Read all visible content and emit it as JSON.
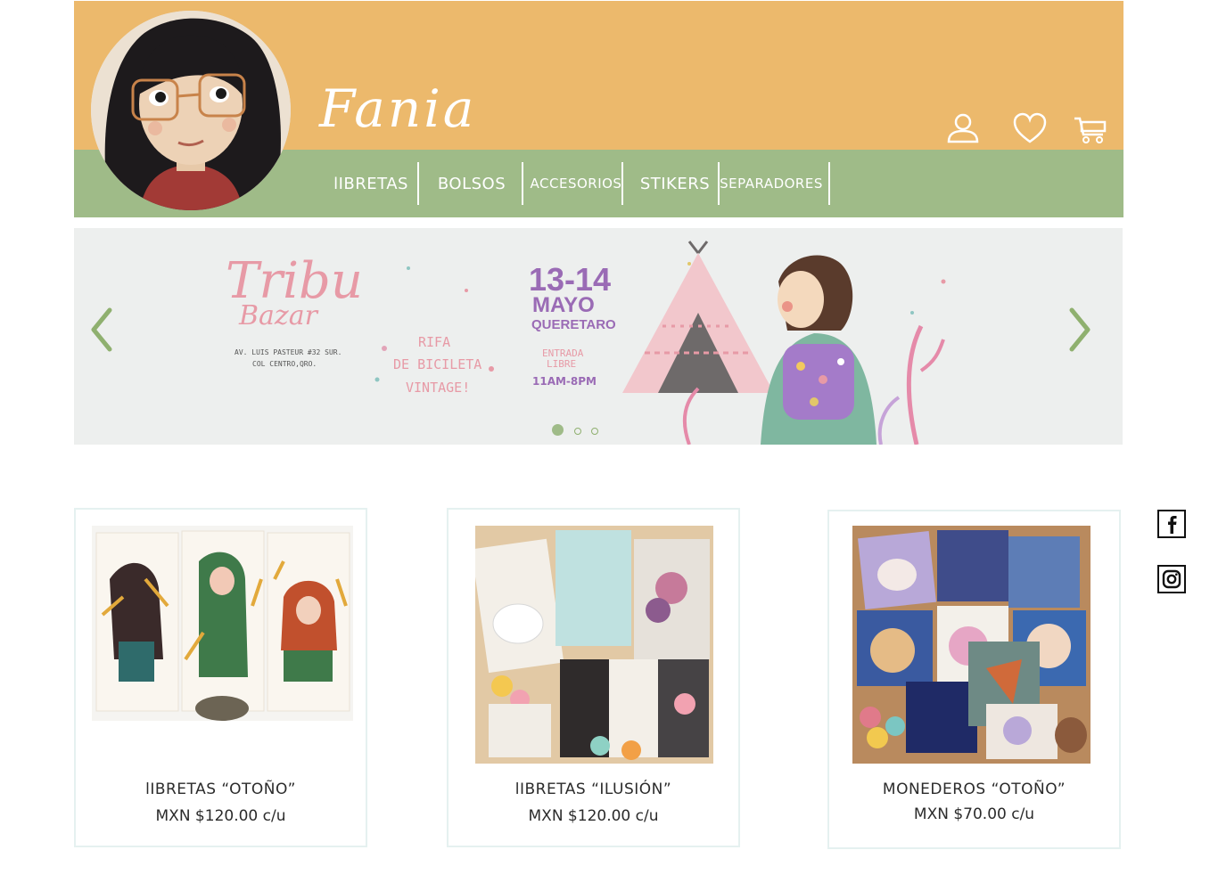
{
  "brand": {
    "logo_text": "Fania"
  },
  "header": {
    "icons": [
      "user-icon",
      "heart-icon",
      "cart-icon"
    ]
  },
  "nav": {
    "items": [
      "lIBRETAS",
      "BOLSOS",
      "ACCESORIOS",
      "STIKERS",
      "SEPARADORES"
    ]
  },
  "hero": {
    "title_line1": "Tribu",
    "title_line2": "Bazar",
    "address_line1": "AV. LUIS PASTEUR #32 SUR.",
    "address_line2": "COL CENTRO,QRO.",
    "raffle": [
      "RIFA",
      "DE BICILETA",
      "VINTAGE!"
    ],
    "dates": "13-14",
    "month": "MAYO",
    "city": "QUERETARO",
    "entry_line1": "ENTRADA",
    "entry_line2": "LIBRE",
    "hours": "11AM-8PM",
    "slide_count": 3,
    "active_slide": 1
  },
  "products": [
    {
      "title": "lIBRETAS “OTOÑO”",
      "price": "MXN $120.00 c/u"
    },
    {
      "title": "lIBRETAS “ILUSIÓN”",
      "price": "MXN $120.00 c/u"
    },
    {
      "title": "MONEDEROS “OTOÑO”",
      "price": "MXN $70.00 c/u"
    }
  ],
  "social": [
    "facebook-icon",
    "instagram-icon"
  ],
  "colors": {
    "header_orange": "#ecb96c",
    "nav_green": "#9fbb88",
    "arrow_green": "#8fb06f",
    "hero_bg": "#edefee",
    "pink_text": "#e79aa6",
    "purple_text": "#9a6bb5"
  }
}
